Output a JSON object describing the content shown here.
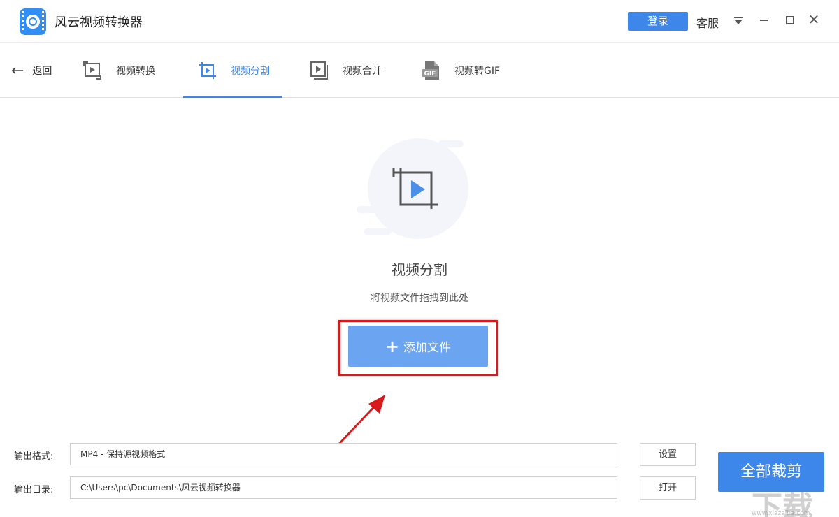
{
  "app": {
    "title": "风云视频转换器"
  },
  "header": {
    "login_label": "登录",
    "service_label": "客服"
  },
  "nav": {
    "back_label": "返回",
    "tabs": [
      {
        "label": "视频转换",
        "active": false
      },
      {
        "label": "视频分割",
        "active": true
      },
      {
        "label": "视频合并",
        "active": false
      },
      {
        "label": "视频转GIF",
        "active": false
      }
    ]
  },
  "main": {
    "headline": "视频分割",
    "hint": "将视频文件拖拽到此处",
    "add_button_label": "添加文件"
  },
  "output": {
    "format_label": "输出格式:",
    "format_value": "MP4 - 保持源视频格式",
    "settings_label": "设置",
    "dir_label": "输出目录:",
    "dir_value": "C:\\Users\\pc\\Documents\\风云视频转换器",
    "open_label": "打开",
    "cut_all_label": "全部裁剪"
  },
  "watermark": {
    "text": "下载",
    "url": "www.xiazaiba.com"
  },
  "colors": {
    "accent": "#3d86ea",
    "add_button": "#6ba4f0",
    "highlight": "#d9191c"
  }
}
